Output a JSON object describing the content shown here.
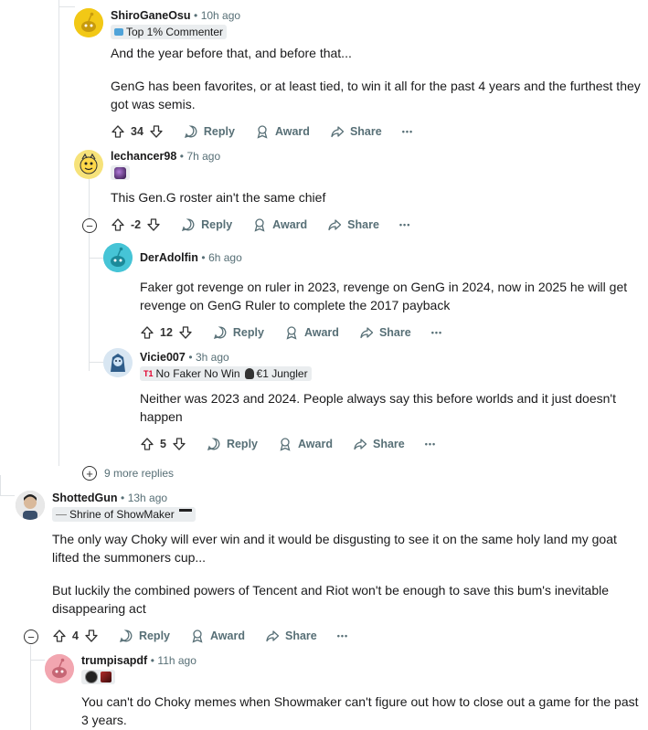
{
  "comments": [
    {
      "author": "ShiroGaneOsu",
      "time": "10h ago",
      "flair": "Top 1% Commenter",
      "body": [
        "And the year before that, and before that...",
        "GenG has been favorites, or at least tied, to win it all for the past 4 years and the furthest they got was semis."
      ],
      "score": "34"
    },
    {
      "author": "lechancer98",
      "time": "7h ago",
      "body": [
        "This Gen.G roster ain't the same chief"
      ],
      "score": "-2"
    },
    {
      "author": "DerAdolfin",
      "time": "6h ago",
      "body": [
        "Faker got revenge on ruler in 2023, revenge on GenG in 2024, now in 2025 he will get revenge on GenG Ruler to complete the 2017 payback"
      ],
      "score": "12"
    },
    {
      "author": "Vicie007",
      "time": "3h ago",
      "flair_a": "No Faker No Win",
      "flair_b": "€1 Jungler",
      "body": [
        "Neither was 2023 and 2024. People always say this before worlds and it just doesn't happen"
      ],
      "score": "5"
    },
    {
      "author": "ShottedGun",
      "time": "13h ago",
      "flair": "Shrine of ShowMaker",
      "body": [
        "The only way Choky will ever win and it would be disgusting to see it on the same holy land my goat lifted the summoners cup...",
        "But luckily the combined powers of Tencent and Riot won't be enough to save this bum's inevitable disappearing act"
      ],
      "score": "4"
    },
    {
      "author": "trumpisapdf",
      "time": "11h ago",
      "body": [
        "You can't do Choky memes when Showmaker can't figure out how to close out a game for the past 3 years."
      ]
    }
  ],
  "actions": {
    "reply": "Reply",
    "award": "Award",
    "share": "Share",
    "more": "•••"
  },
  "more_replies": "9 more replies",
  "separator": "•",
  "colors": {
    "meta": "#576f76",
    "thread_line": "#e0e3e6",
    "flair_bg": "#eaedef",
    "t1_red": "#e2012d"
  }
}
